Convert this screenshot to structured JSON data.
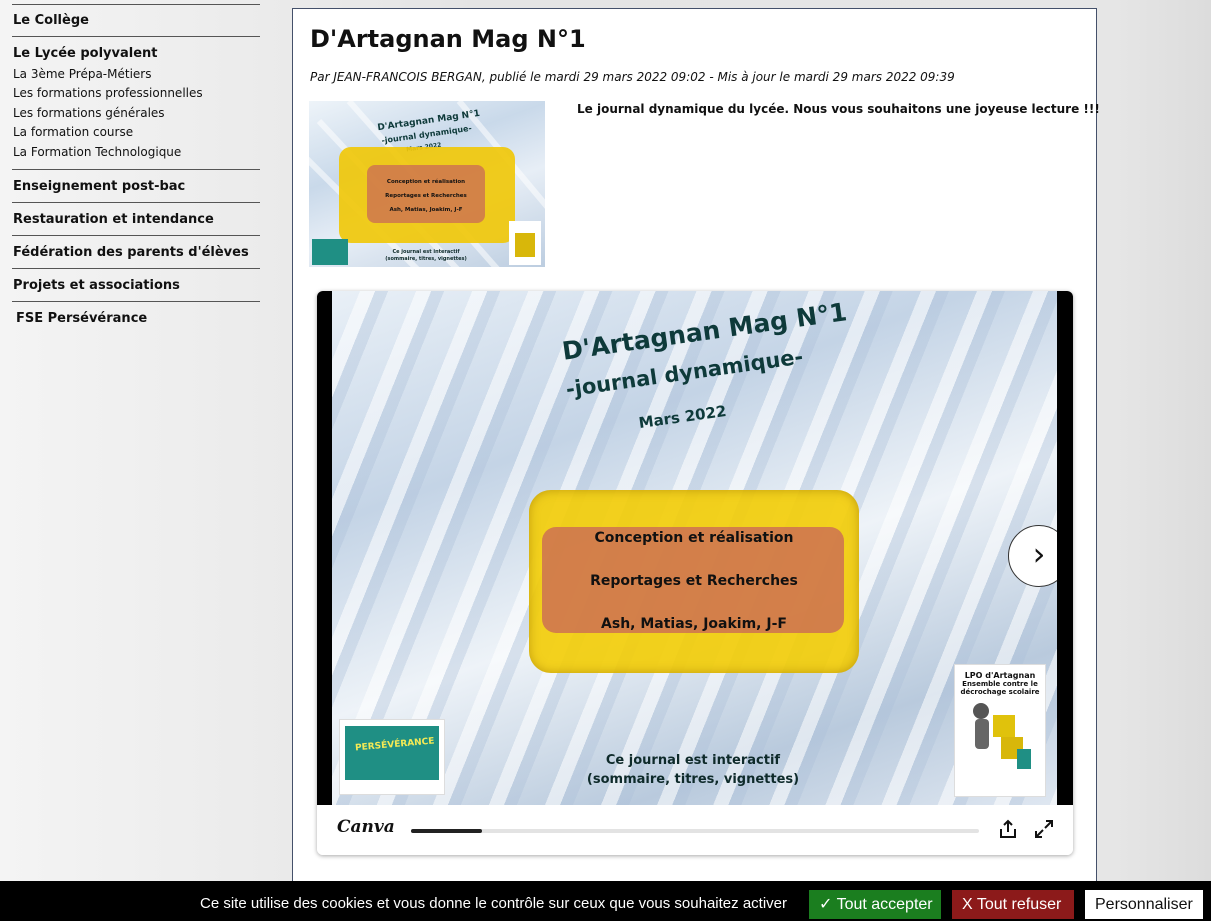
{
  "sidebar": {
    "sections": [
      {
        "label": "Le Collège"
      },
      {
        "label": "Le Lycée polyvalent",
        "items": [
          "La 3ème Prépa-Métiers",
          "Les formations professionnelles",
          "Les formations générales",
          "La formation course",
          "La Formation Technologique"
        ]
      },
      {
        "label": "Enseignement post-bac"
      },
      {
        "label": "Restauration et intendance"
      },
      {
        "label": "Fédération des parents d'élèves"
      },
      {
        "label": "Projets et associations"
      },
      {
        "label": "FSE Persévérance"
      }
    ]
  },
  "article": {
    "title": "D'Artagnan Mag N°1",
    "byline": "Par JEAN-FRANCOIS BERGAN, publié le mardi 29 mars 2022 09:02 - Mis à jour le mardi 29 mars 2022 09:39",
    "intro": "Le journal dynamique du lycée. Nous vous souhaitons une joyeuse lecture !!!"
  },
  "slide": {
    "title": "D'Artagnan Mag N°1",
    "subtitle": "-journal dynamique-",
    "date": "Mars 2022",
    "credits": [
      "Conception et réalisation",
      "Reportages et Recherches",
      "Ash, Matias, Joakim, J-F"
    ],
    "interactive_line1": "Ce journal est interactif",
    "interactive_line2": "(sommaire, titres, vignettes)",
    "logo_right_title": "LPO d'Artagnan",
    "logo_right_sub": "Ensemble contre le décrochage scolaire",
    "logo_left_text": "PERSÉVÉRANCE",
    "next_icon": "chevron-right-icon"
  },
  "player": {
    "brand": "Canva",
    "progress": 0.125,
    "share_icon": "share-icon",
    "fullscreen_icon": "fullscreen-icon"
  },
  "cookie": {
    "text": "Ce site utilise des cookies et vous donne le contrôle sur ceux que vous souhaitez activer",
    "accept": "✓ Tout accepter",
    "refuse": "X Tout refuser",
    "customize": "Personnaliser",
    "accept_color": "#1b7e1f",
    "refuse_color": "#8c1a1a"
  }
}
